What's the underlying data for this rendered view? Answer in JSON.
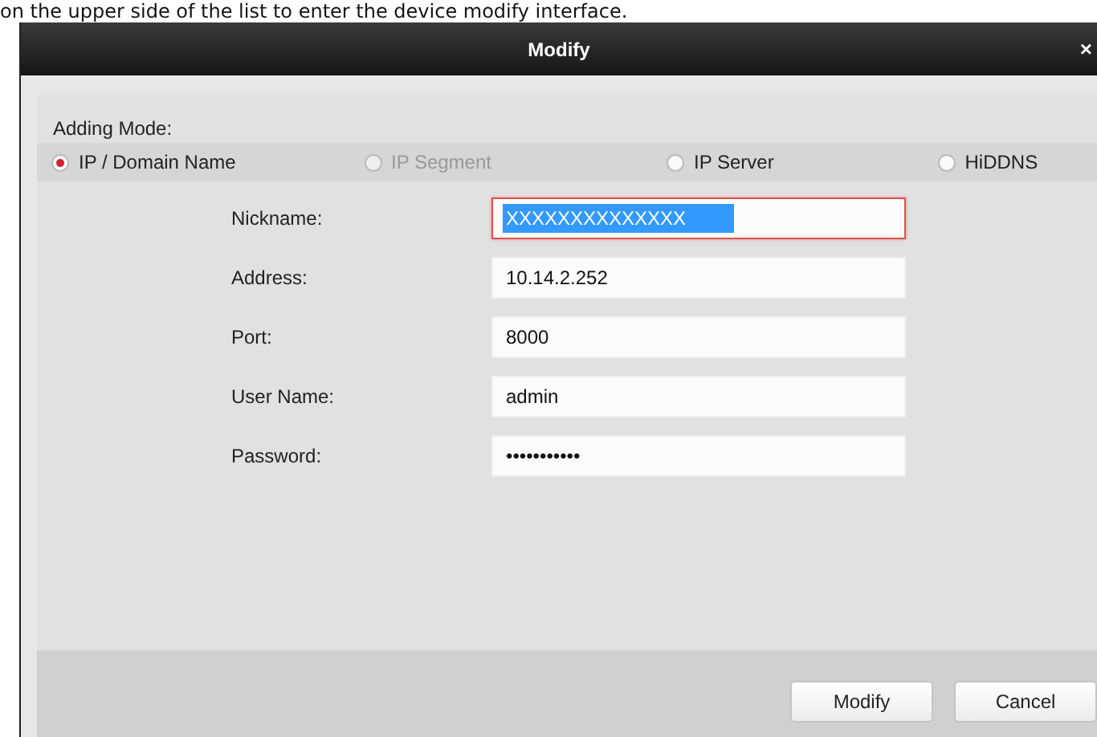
{
  "caption": "on the upper side of the list to enter the device modify interface.",
  "window": {
    "title": "Modify",
    "close": "×"
  },
  "adding_mode": {
    "label": "Adding Mode:",
    "options": [
      {
        "label": "IP / Domain Name",
        "selected": true,
        "disabled": false
      },
      {
        "label": "IP Segment",
        "selected": false,
        "disabled": true
      },
      {
        "label": "IP Server",
        "selected": false,
        "disabled": false
      },
      {
        "label": "HiDDNS",
        "selected": false,
        "disabled": false
      }
    ]
  },
  "fields": [
    {
      "label": "Nickname:",
      "value": "XXXXXXXXXXXXXX",
      "focused": true
    },
    {
      "label": "Address:",
      "value": "10.14.2.252",
      "focused": false
    },
    {
      "label": "Port:",
      "value": "8000",
      "focused": false
    },
    {
      "label": "User Name:",
      "value": "admin",
      "focused": false
    },
    {
      "label": "Password:",
      "value": "•••••••••••",
      "focused": false
    }
  ],
  "buttons": [
    "Modify",
    "Cancel"
  ]
}
